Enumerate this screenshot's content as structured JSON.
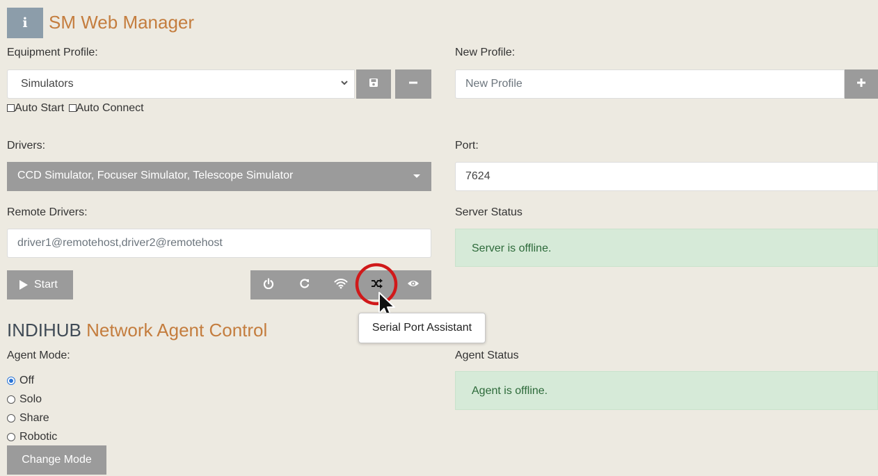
{
  "header": {
    "info_icon_glyph": "i",
    "title": "SM Web Manager"
  },
  "profile": {
    "label": "Equipment Profile:",
    "selected": "Simulators",
    "auto_start_label": "Auto Start",
    "auto_connect_label": "Auto Connect"
  },
  "new_profile": {
    "label": "New Profile:",
    "placeholder": "New Profile"
  },
  "drivers": {
    "label": "Drivers:",
    "selected": "CCD Simulator, Focuser Simulator, Telescope Simulator"
  },
  "port": {
    "label": "Port:",
    "value": "7624"
  },
  "remote_drivers": {
    "label": "Remote Drivers:",
    "placeholder": "driver1@remotehost,driver2@remotehost"
  },
  "server_status": {
    "label": "Server Status",
    "text": "Server is offline."
  },
  "controls": {
    "start_label": "Start",
    "tooltip": "Serial Port Assistant",
    "icons": [
      "power-icon",
      "restart-icon",
      "wifi-icon",
      "shuffle-icon",
      "eye-icon"
    ]
  },
  "indihub": {
    "title_prefix": "INDIHUB",
    "title_suffix": "Network Agent Control"
  },
  "agent": {
    "mode_label": "Agent Mode:",
    "modes": [
      "Off",
      "Solo",
      "Share",
      "Robotic"
    ],
    "selected_mode": "Off",
    "change_mode_label": "Change Mode",
    "status_label": "Agent Status",
    "status_text": "Agent is offline."
  },
  "colors": {
    "background": "#edeae1",
    "accent": "#c47d3e",
    "button_gray": "#9b9b9b",
    "success_bg": "#d6ead8",
    "highlight_ring": "#d0191a"
  }
}
